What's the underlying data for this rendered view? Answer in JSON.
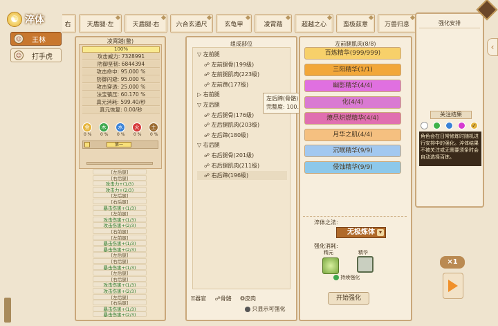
{
  "header": {
    "title": "淬体"
  },
  "characters": [
    {
      "name": "王林",
      "active": true
    },
    {
      "name": "打手虎",
      "active": false
    }
  ],
  "tabs": [
    {
      "label": "右"
    },
    {
      "label": "天盾腿·左"
    },
    {
      "label": "天盾腿·右"
    },
    {
      "label": "六合玄通尺"
    },
    {
      "label": "玄龟甲"
    },
    {
      "label": "凌霄踏"
    },
    {
      "label": "超越之心"
    },
    {
      "label": "蛮极兹意"
    },
    {
      "label": "万兽归息"
    }
  ],
  "stats_panel": {
    "title": "凌霄踏(鳖)",
    "progress": "100%",
    "progress_fraction": 1.0,
    "rows": [
      "攻击威力: 7328991",
      "防御坚韧: 6844394",
      "攻击命中: 95.000 %",
      "防御闪避: 95.000 %",
      "攻击穿透: 25.000 %",
      "法宝镇压: 60.170 %",
      "真元消耗: 599.40/秒",
      "真元恢复: 0.00/秒"
    ],
    "elements": [
      {
        "label": "金",
        "pct": "0 %",
        "color": "#e6b43a"
      },
      {
        "label": "木",
        "pct": "0 %",
        "color": "#3fa84e"
      },
      {
        "label": "水",
        "pct": "0 %",
        "color": "#3a82d6"
      },
      {
        "label": "火",
        "pct": "0 %",
        "color": "#d63a3a"
      },
      {
        "label": "土",
        "pct": "0 %",
        "color": "#9a6a30"
      }
    ],
    "mini_item_label": "第一",
    "slots": [
      {
        "text": "[左后腿]",
        "kind": "lock"
      },
      {
        "text": "[右后腿]",
        "kind": "lock"
      },
      {
        "text": "攻击力+(1/3)",
        "kind": "green"
      },
      {
        "text": "攻击力+(2/3)",
        "kind": "green"
      },
      {
        "text": "[左后腿]",
        "kind": "lock"
      },
      {
        "text": "[右后腿]",
        "kind": "lock"
      },
      {
        "text": "暴击伤害+(1/3)",
        "kind": "green"
      },
      {
        "text": "[左前腿]",
        "kind": "lock"
      },
      {
        "text": "攻击伤害+(1/3)",
        "kind": "green"
      },
      {
        "text": "攻击伤害+(2/3)",
        "kind": "green"
      },
      {
        "text": "[右前腿]",
        "kind": "lock"
      },
      {
        "text": "[左前腿]",
        "kind": "lock"
      },
      {
        "text": "暴击伤害+(1/3)",
        "kind": "green"
      },
      {
        "text": "暴击伤害+(2/3)",
        "kind": "green"
      },
      {
        "text": "[左后腿]",
        "kind": "lock"
      },
      {
        "text": "[右后腿]",
        "kind": "lock"
      },
      {
        "text": "暴击伤害+(1/3)",
        "kind": "green"
      },
      {
        "text": "[左后腿]",
        "kind": "lock"
      },
      {
        "text": "[右后腿]",
        "kind": "lock"
      },
      {
        "text": "攻击伤害+(1/3)",
        "kind": "green"
      },
      {
        "text": "攻击伤害+(2/3)",
        "kind": "green"
      },
      {
        "text": "[左后腿]",
        "kind": "lock"
      },
      {
        "text": "[右后腿]",
        "kind": "lock"
      },
      {
        "text": "暴击伤害+(1/3)",
        "kind": "green"
      },
      {
        "text": "暴击伤害+(2/3)",
        "kind": "green"
      }
    ]
  },
  "parts_panel": {
    "title": "组成部位",
    "tree": [
      {
        "text": "左前腿",
        "level": 0,
        "expanded": true
      },
      {
        "text": "左前腿骨(199级)",
        "level": 1
      },
      {
        "text": "左前腿肌肉(223级)",
        "level": 1
      },
      {
        "text": "左前蹄(177级)",
        "level": 1
      },
      {
        "text": "右前腿",
        "level": 0,
        "expanded": false
      },
      {
        "text": "左后腿",
        "level": 0,
        "expanded": true
      },
      {
        "text": "左后腿骨(176级)",
        "level": 1
      },
      {
        "text": "左后腿肌肉(203级)",
        "level": 1
      },
      {
        "text": "左后蹄(180级)",
        "level": 1,
        "selected": true
      },
      {
        "text": "右后腿",
        "level": 0,
        "expanded": true
      },
      {
        "text": "右后腿骨(201级)",
        "level": 1
      },
      {
        "text": "右后腿肌肉(211级)",
        "level": 1
      },
      {
        "text": "右后蹄(196级)",
        "level": 1
      }
    ],
    "legend": [
      "器官",
      "骨骼",
      "皮肉"
    ],
    "filter_label": "只显示可强化"
  },
  "tooltip": {
    "line1": "左后蹄(骨骼)",
    "line2": "完整度: 100.00 %"
  },
  "list_panel": {
    "title": "左前腿肌肉(8/8)",
    "essences": [
      {
        "label": "百炼精华(999/999)",
        "bg": "#f7d06a"
      },
      {
        "label": "三阳精华(1/1)",
        "bg": "#f2a73a"
      },
      {
        "label": "幽影精华(4/4)",
        "bg": "#e070e0"
      },
      {
        "label": "化(4/4)",
        "bg": "#d97ad2"
      },
      {
        "label": "燎尽炽燃精华(4/4)",
        "bg": "#e06fb0"
      },
      {
        "label": "月华之肌(4/4)",
        "bg": "#f5c080"
      },
      {
        "label": "沉眠精华(9/9)",
        "bg": "#a2c8f0"
      },
      {
        "label": "侵蚀精华(9/9)",
        "bg": "#8dc8ea"
      }
    ],
    "forge_title": "淬体之法:",
    "forge_value": "无极炼体",
    "consume_title": "强化消耗:",
    "consume_items": [
      {
        "label": "精元"
      },
      {
        "label": "精华"
      }
    ],
    "continuous_label": "持续强化",
    "start_label": "开始强化"
  },
  "strengthen": {
    "title": "强化安排",
    "focus_title": "关注结果",
    "colors": [
      "#ffffff",
      "#3fb24a",
      "#3a82d6",
      "#d63ad0",
      "#e3b23a"
    ],
    "note": "角色会在日常修炼时随机进行安排中的强化。淬体结果不被关注或无需要须条时会自动选择百炼。"
  },
  "speed": "×1"
}
